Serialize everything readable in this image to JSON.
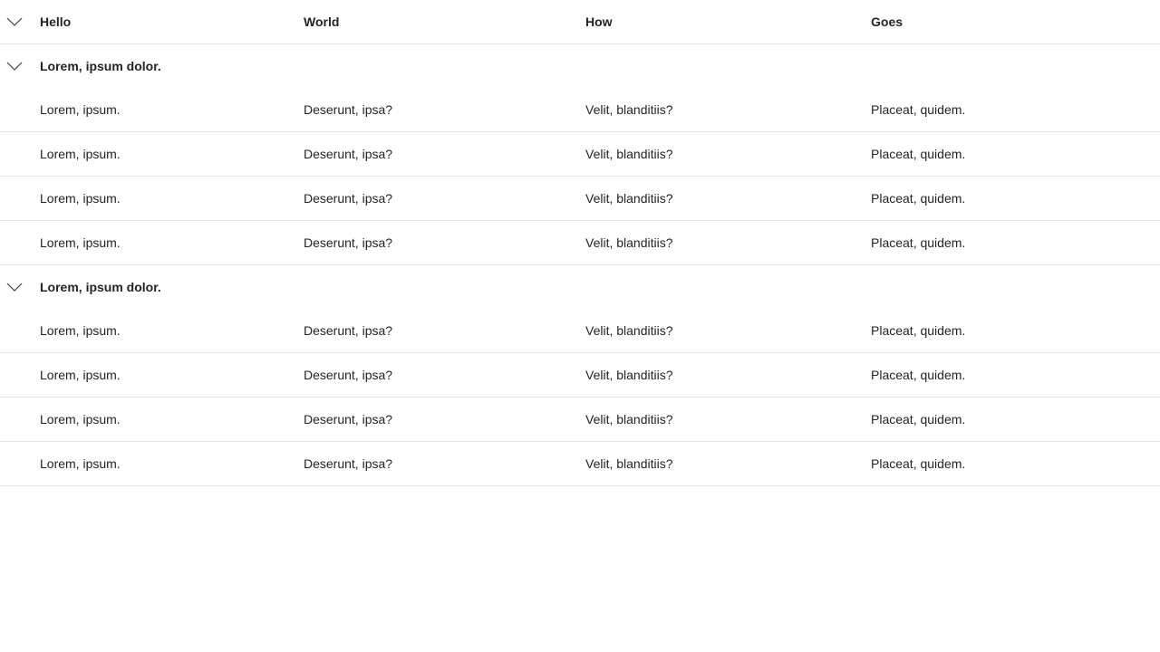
{
  "columns": [
    "Hello",
    "World",
    "How",
    "Goes"
  ],
  "groups": [
    {
      "title": "Lorem, ipsum dolor.",
      "expanded": true,
      "rows": [
        [
          "Lorem, ipsum.",
          "Deserunt, ipsa?",
          "Velit, blanditiis?",
          "Placeat, quidem."
        ],
        [
          "Lorem, ipsum.",
          "Deserunt, ipsa?",
          "Velit, blanditiis?",
          "Placeat, quidem."
        ],
        [
          "Lorem, ipsum.",
          "Deserunt, ipsa?",
          "Velit, blanditiis?",
          "Placeat, quidem."
        ],
        [
          "Lorem, ipsum.",
          "Deserunt, ipsa?",
          "Velit, blanditiis?",
          "Placeat, quidem."
        ]
      ]
    },
    {
      "title": "Lorem, ipsum dolor.",
      "expanded": true,
      "rows": [
        [
          "Lorem, ipsum.",
          "Deserunt, ipsa?",
          "Velit, blanditiis?",
          "Placeat, quidem."
        ],
        [
          "Lorem, ipsum.",
          "Deserunt, ipsa?",
          "Velit, blanditiis?",
          "Placeat, quidem."
        ],
        [
          "Lorem, ipsum.",
          "Deserunt, ipsa?",
          "Velit, blanditiis?",
          "Placeat, quidem."
        ],
        [
          "Lorem, ipsum.",
          "Deserunt, ipsa?",
          "Velit, blanditiis?",
          "Placeat, quidem."
        ]
      ]
    }
  ],
  "icons": {
    "expand_all": "chevron-down-icon",
    "group_toggle": "chevron-down-icon"
  },
  "colors": {
    "text": "#242424",
    "divider": "#e5e5e5",
    "background": "#ffffff"
  }
}
